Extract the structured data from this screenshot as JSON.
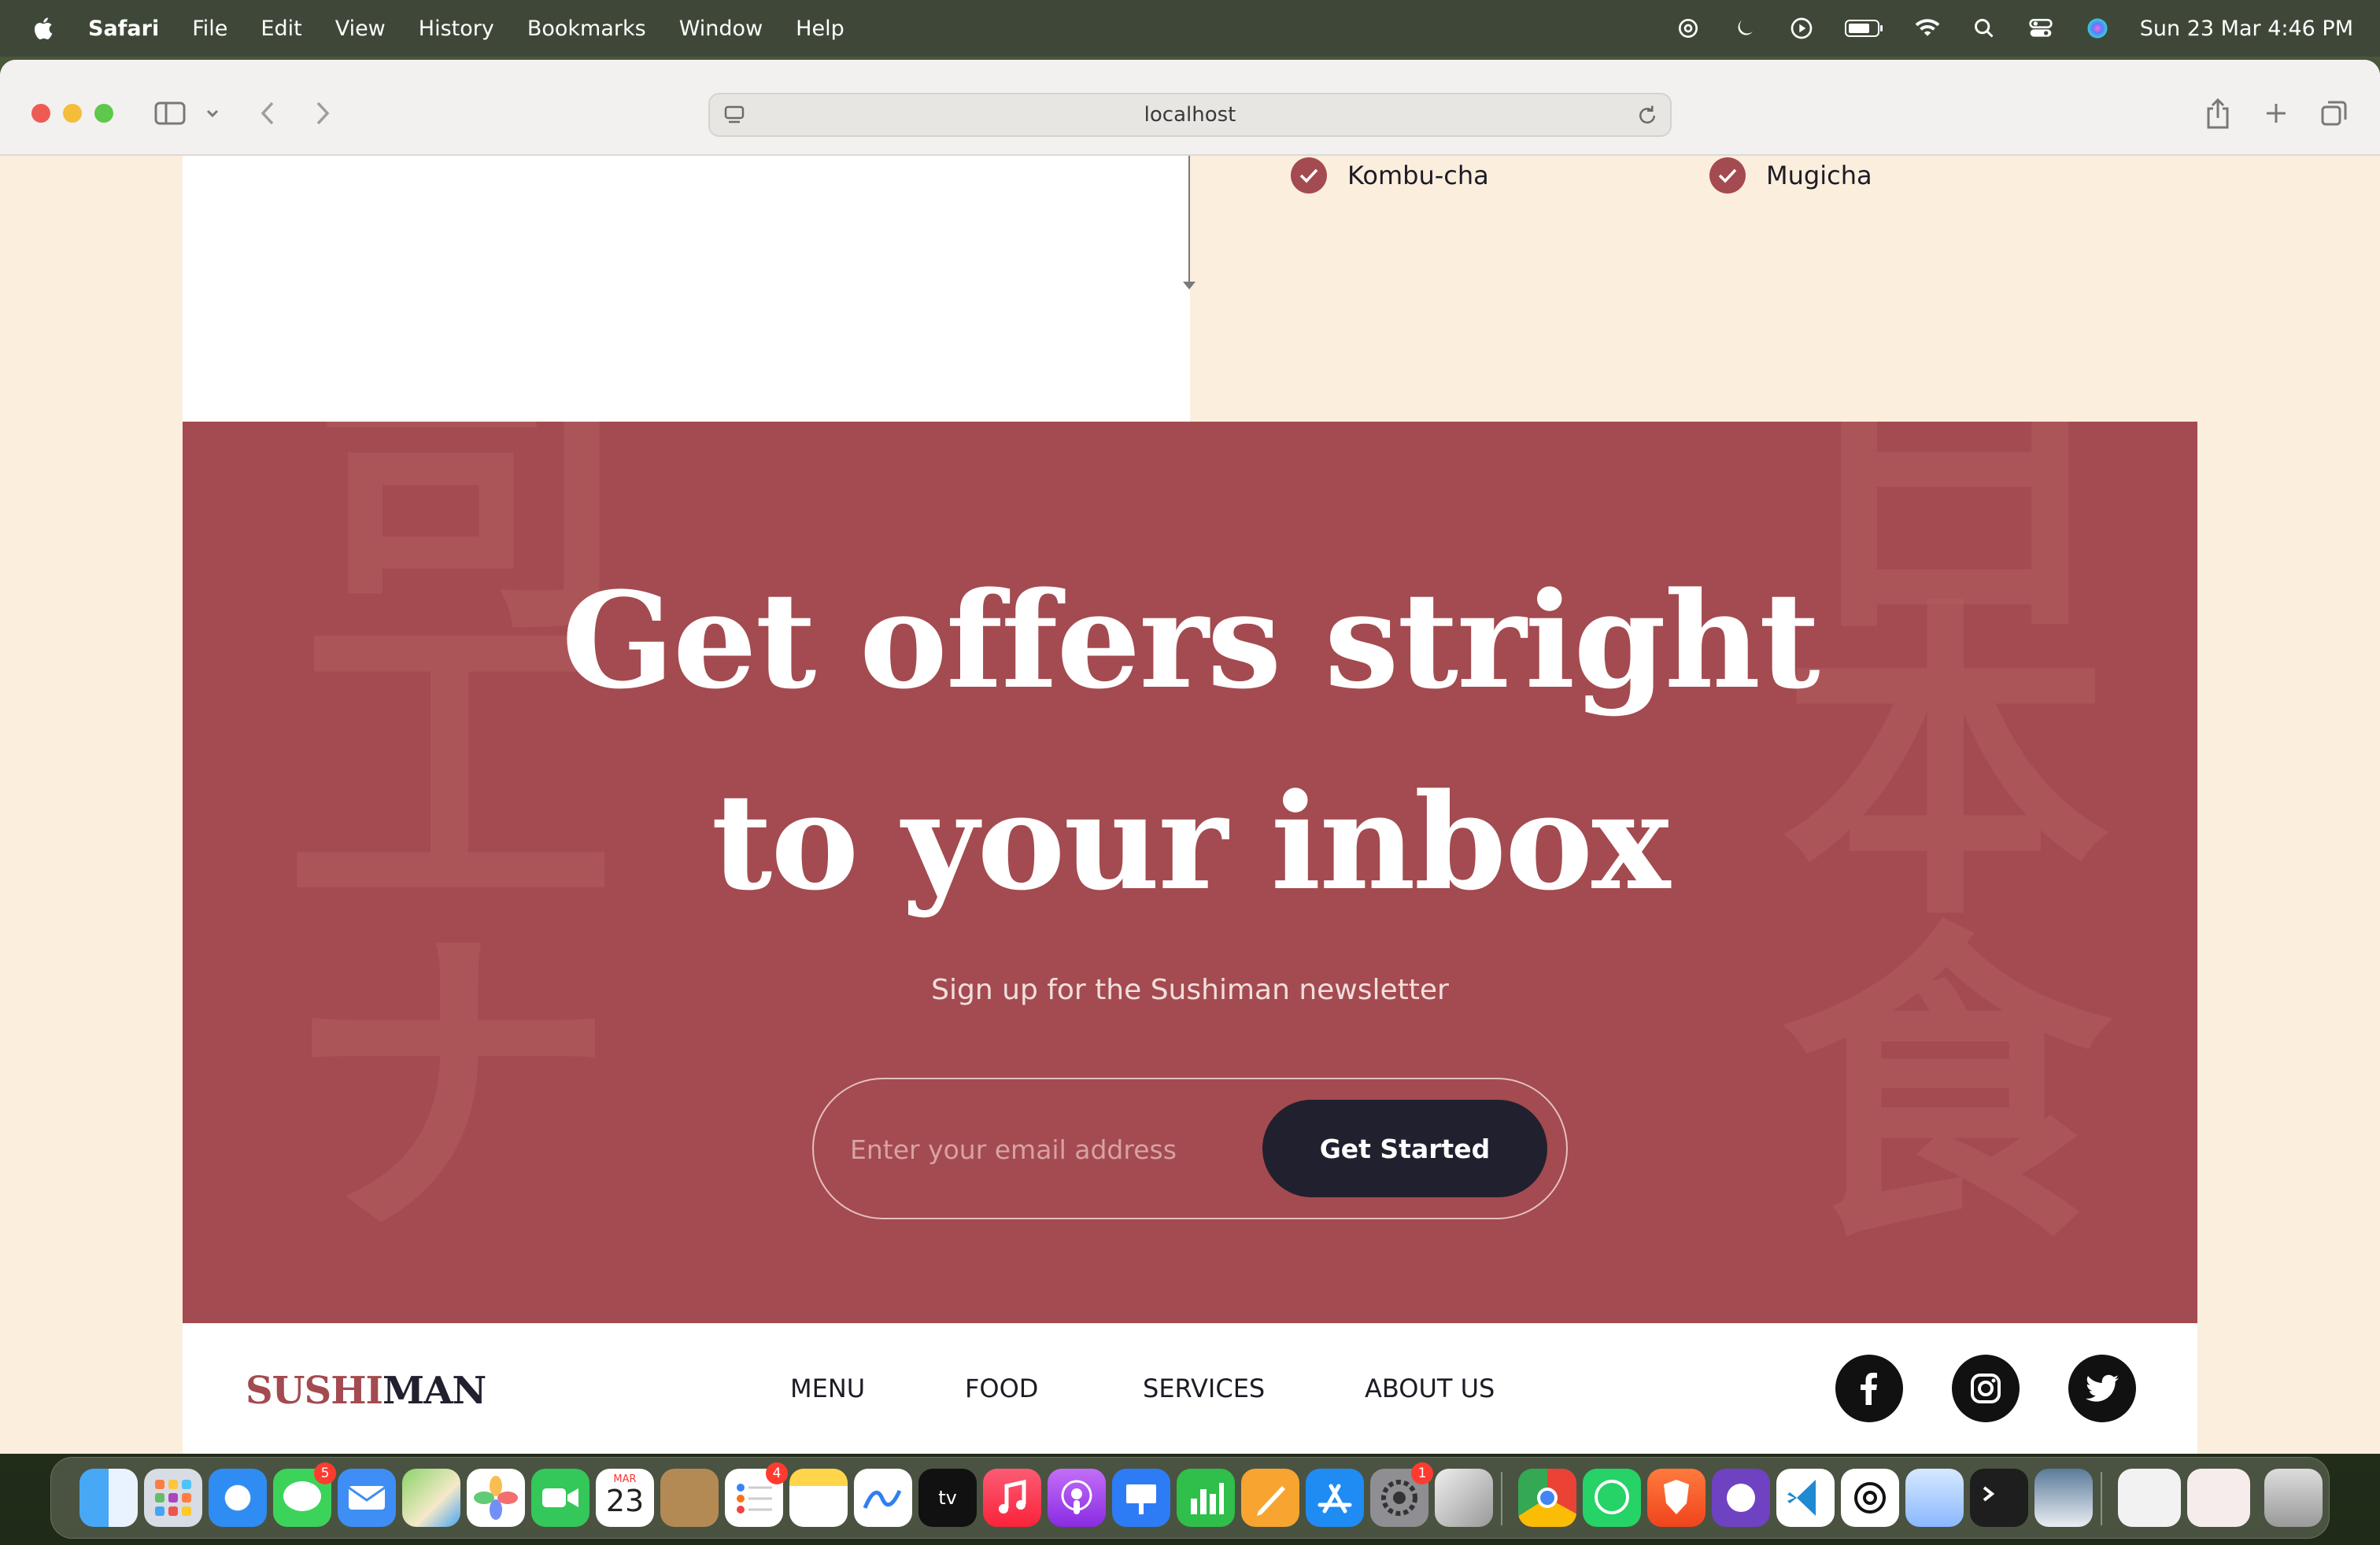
{
  "menubar": {
    "app_name": "Safari",
    "items": [
      "File",
      "Edit",
      "View",
      "History",
      "Bookmarks",
      "Window",
      "Help"
    ],
    "clock": "Sun 23 Mar  4:46 PM"
  },
  "browser": {
    "url": "localhost"
  },
  "drinks": {
    "items": [
      "Kombu-cha",
      "Mugicha"
    ]
  },
  "newsletter": {
    "headline_line1": "Get offers stright",
    "headline_line2": "to your inbox",
    "subtitle": "Sign up for the Sushiman newsletter",
    "email_placeholder": "Enter your email address",
    "cta_label": "Get Started",
    "bg_kanji": [
      "司",
      "工",
      "ナ",
      "日",
      "本",
      "食"
    ]
  },
  "footer": {
    "logo_part1": "SUSHI",
    "logo_part2": "MAN",
    "nav": [
      "MENU",
      "FOOD",
      "SERVICES",
      "ABOUT US"
    ],
    "social": [
      "facebook-icon",
      "instagram-icon",
      "twitter-icon"
    ]
  },
  "dock": {
    "calendar_month": "MAR",
    "calendar_day": "23",
    "messages_badge": "5",
    "reminders_badge": "4",
    "settings_badge": "1"
  },
  "colors": {
    "accent": "#a34b50",
    "dark": "#21202f",
    "page_bg": "#fbeedd"
  }
}
